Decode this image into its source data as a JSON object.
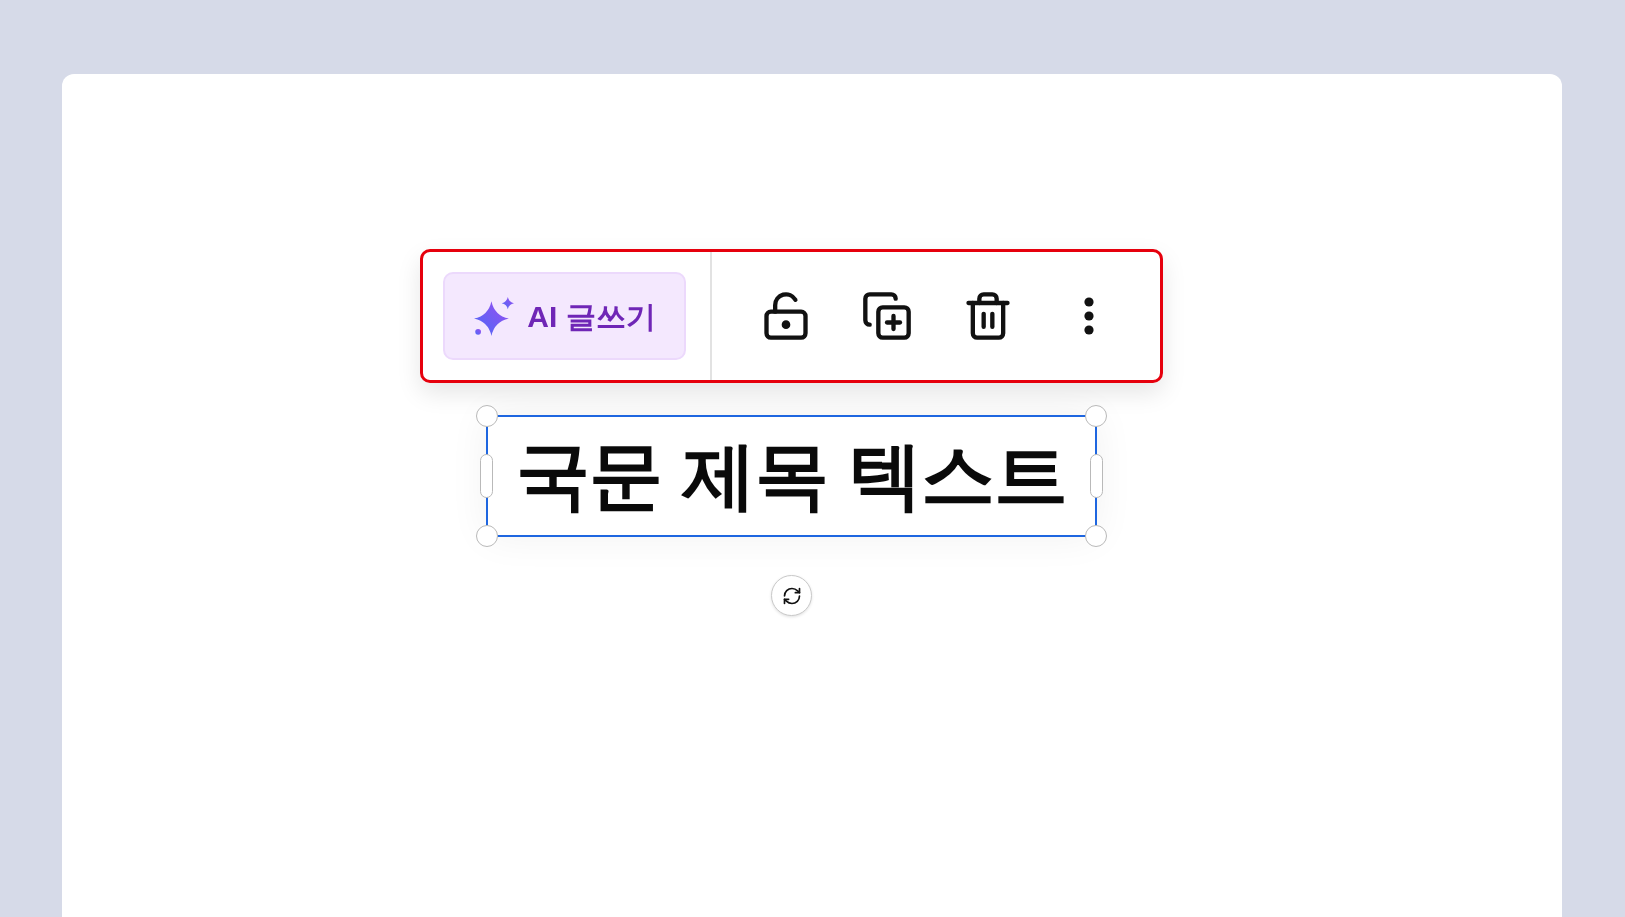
{
  "toolbar": {
    "highlighted": true,
    "ai_button": "AI 글쓰기"
  },
  "text_box": {
    "text": "국문 제목 텍스트",
    "selected": true
  }
}
